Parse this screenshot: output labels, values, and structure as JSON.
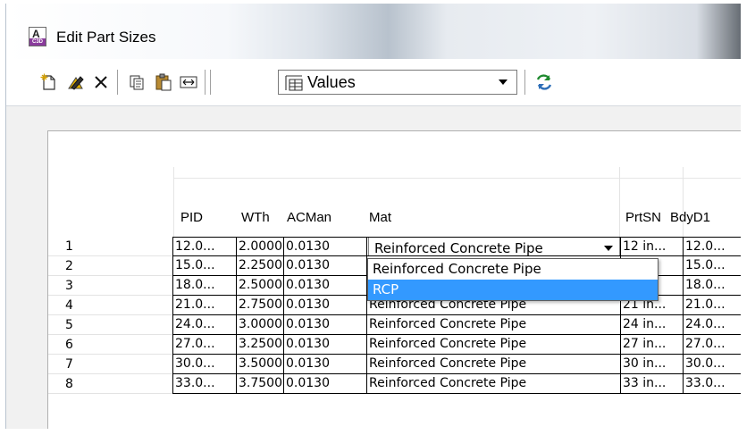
{
  "window": {
    "title": "Edit Part Sizes"
  },
  "toolbar": {
    "view_combo": {
      "selected": "Values"
    }
  },
  "table": {
    "columns": [
      "PID",
      "WTh",
      "ACMan",
      "Mat",
      "PrtSN",
      "BdyD1"
    ],
    "rows": [
      {
        "num": "1",
        "pid": "12.0...",
        "wth": "2.0000",
        "acman": "0.0130",
        "mat": "Reinforced Concrete Pipe",
        "prtsn": "12 in...",
        "bdyd1": "12.0..."
      },
      {
        "num": "2",
        "pid": "15.0...",
        "wth": "2.2500",
        "acman": "0.0130",
        "mat": "",
        "prtsn": "",
        "bdyd1": "15.0..."
      },
      {
        "num": "3",
        "pid": "18.0...",
        "wth": "2.5000",
        "acman": "0.0130",
        "mat": "",
        "prtsn": "",
        "bdyd1": "18.0..."
      },
      {
        "num": "4",
        "pid": "21.0...",
        "wth": "2.7500",
        "acman": "0.0130",
        "mat": "Reinforced Concrete Pipe",
        "prtsn": "21 in...",
        "bdyd1": "21.0..."
      },
      {
        "num": "5",
        "pid": "24.0...",
        "wth": "3.0000",
        "acman": "0.0130",
        "mat": "Reinforced Concrete Pipe",
        "prtsn": "24 in...",
        "bdyd1": "24.0..."
      },
      {
        "num": "6",
        "pid": "27.0...",
        "wth": "3.2500",
        "acman": "0.0130",
        "mat": "Reinforced Concrete Pipe",
        "prtsn": "27 in...",
        "bdyd1": "27.0..."
      },
      {
        "num": "7",
        "pid": "30.0...",
        "wth": "3.5000",
        "acman": "0.0130",
        "mat": "Reinforced Concrete Pipe",
        "prtsn": "30 in...",
        "bdyd1": "30.0..."
      },
      {
        "num": "8",
        "pid": "33.0...",
        "wth": "3.7500",
        "acman": "0.0130",
        "mat": "Reinforced Concrete Pipe",
        "prtsn": "33 in...",
        "bdyd1": "33.0..."
      }
    ],
    "mat_dropdown": {
      "current": "Reinforced Concrete Pipe",
      "options": [
        "Reinforced Concrete Pipe",
        "RCP"
      ],
      "highlighted": "RCP"
    }
  },
  "colors": {
    "selection": "#3399ff",
    "grid_line": "#000000",
    "panel_bg": "#f1f1f1"
  }
}
